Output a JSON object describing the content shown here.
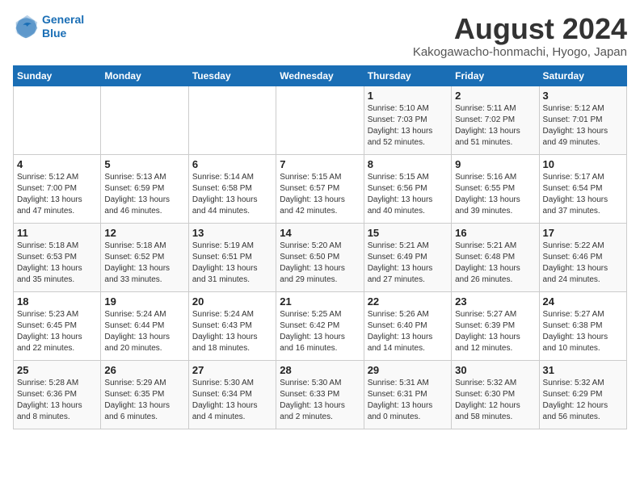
{
  "logo": {
    "line1": "General",
    "line2": "Blue"
  },
  "title": "August 2024",
  "subtitle": "Kakogawacho-honmachi, Hyogo, Japan",
  "weekdays": [
    "Sunday",
    "Monday",
    "Tuesday",
    "Wednesday",
    "Thursday",
    "Friday",
    "Saturday"
  ],
  "weeks": [
    [
      {
        "day": "",
        "detail": ""
      },
      {
        "day": "",
        "detail": ""
      },
      {
        "day": "",
        "detail": ""
      },
      {
        "day": "",
        "detail": ""
      },
      {
        "day": "1",
        "detail": "Sunrise: 5:10 AM\nSunset: 7:03 PM\nDaylight: 13 hours\nand 52 minutes."
      },
      {
        "day": "2",
        "detail": "Sunrise: 5:11 AM\nSunset: 7:02 PM\nDaylight: 13 hours\nand 51 minutes."
      },
      {
        "day": "3",
        "detail": "Sunrise: 5:12 AM\nSunset: 7:01 PM\nDaylight: 13 hours\nand 49 minutes."
      }
    ],
    [
      {
        "day": "4",
        "detail": "Sunrise: 5:12 AM\nSunset: 7:00 PM\nDaylight: 13 hours\nand 47 minutes."
      },
      {
        "day": "5",
        "detail": "Sunrise: 5:13 AM\nSunset: 6:59 PM\nDaylight: 13 hours\nand 46 minutes."
      },
      {
        "day": "6",
        "detail": "Sunrise: 5:14 AM\nSunset: 6:58 PM\nDaylight: 13 hours\nand 44 minutes."
      },
      {
        "day": "7",
        "detail": "Sunrise: 5:15 AM\nSunset: 6:57 PM\nDaylight: 13 hours\nand 42 minutes."
      },
      {
        "day": "8",
        "detail": "Sunrise: 5:15 AM\nSunset: 6:56 PM\nDaylight: 13 hours\nand 40 minutes."
      },
      {
        "day": "9",
        "detail": "Sunrise: 5:16 AM\nSunset: 6:55 PM\nDaylight: 13 hours\nand 39 minutes."
      },
      {
        "day": "10",
        "detail": "Sunrise: 5:17 AM\nSunset: 6:54 PM\nDaylight: 13 hours\nand 37 minutes."
      }
    ],
    [
      {
        "day": "11",
        "detail": "Sunrise: 5:18 AM\nSunset: 6:53 PM\nDaylight: 13 hours\nand 35 minutes."
      },
      {
        "day": "12",
        "detail": "Sunrise: 5:18 AM\nSunset: 6:52 PM\nDaylight: 13 hours\nand 33 minutes."
      },
      {
        "day": "13",
        "detail": "Sunrise: 5:19 AM\nSunset: 6:51 PM\nDaylight: 13 hours\nand 31 minutes."
      },
      {
        "day": "14",
        "detail": "Sunrise: 5:20 AM\nSunset: 6:50 PM\nDaylight: 13 hours\nand 29 minutes."
      },
      {
        "day": "15",
        "detail": "Sunrise: 5:21 AM\nSunset: 6:49 PM\nDaylight: 13 hours\nand 27 minutes."
      },
      {
        "day": "16",
        "detail": "Sunrise: 5:21 AM\nSunset: 6:48 PM\nDaylight: 13 hours\nand 26 minutes."
      },
      {
        "day": "17",
        "detail": "Sunrise: 5:22 AM\nSunset: 6:46 PM\nDaylight: 13 hours\nand 24 minutes."
      }
    ],
    [
      {
        "day": "18",
        "detail": "Sunrise: 5:23 AM\nSunset: 6:45 PM\nDaylight: 13 hours\nand 22 minutes."
      },
      {
        "day": "19",
        "detail": "Sunrise: 5:24 AM\nSunset: 6:44 PM\nDaylight: 13 hours\nand 20 minutes."
      },
      {
        "day": "20",
        "detail": "Sunrise: 5:24 AM\nSunset: 6:43 PM\nDaylight: 13 hours\nand 18 minutes."
      },
      {
        "day": "21",
        "detail": "Sunrise: 5:25 AM\nSunset: 6:42 PM\nDaylight: 13 hours\nand 16 minutes."
      },
      {
        "day": "22",
        "detail": "Sunrise: 5:26 AM\nSunset: 6:40 PM\nDaylight: 13 hours\nand 14 minutes."
      },
      {
        "day": "23",
        "detail": "Sunrise: 5:27 AM\nSunset: 6:39 PM\nDaylight: 13 hours\nand 12 minutes."
      },
      {
        "day": "24",
        "detail": "Sunrise: 5:27 AM\nSunset: 6:38 PM\nDaylight: 13 hours\nand 10 minutes."
      }
    ],
    [
      {
        "day": "25",
        "detail": "Sunrise: 5:28 AM\nSunset: 6:36 PM\nDaylight: 13 hours\nand 8 minutes."
      },
      {
        "day": "26",
        "detail": "Sunrise: 5:29 AM\nSunset: 6:35 PM\nDaylight: 13 hours\nand 6 minutes."
      },
      {
        "day": "27",
        "detail": "Sunrise: 5:30 AM\nSunset: 6:34 PM\nDaylight: 13 hours\nand 4 minutes."
      },
      {
        "day": "28",
        "detail": "Sunrise: 5:30 AM\nSunset: 6:33 PM\nDaylight: 13 hours\nand 2 minutes."
      },
      {
        "day": "29",
        "detail": "Sunrise: 5:31 AM\nSunset: 6:31 PM\nDaylight: 13 hours\nand 0 minutes."
      },
      {
        "day": "30",
        "detail": "Sunrise: 5:32 AM\nSunset: 6:30 PM\nDaylight: 12 hours\nand 58 minutes."
      },
      {
        "day": "31",
        "detail": "Sunrise: 5:32 AM\nSunset: 6:29 PM\nDaylight: 12 hours\nand 56 minutes."
      }
    ]
  ]
}
